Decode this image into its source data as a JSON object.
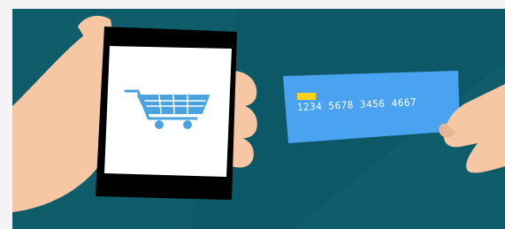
{
  "illustration": {
    "colors": {
      "background": "#0f5c6a",
      "frame": "#f4f4f6",
      "skin": "#f7c6a3",
      "phone_body": "#000000",
      "phone_screen": "#ffffff",
      "cart": "#4aa3df",
      "card": "#4aa3f0",
      "card_chip": "#ffd21a"
    },
    "phone": {
      "screen_icon": "shopping-cart-icon"
    },
    "card": {
      "number": "1234 5678 3456 4667"
    }
  }
}
